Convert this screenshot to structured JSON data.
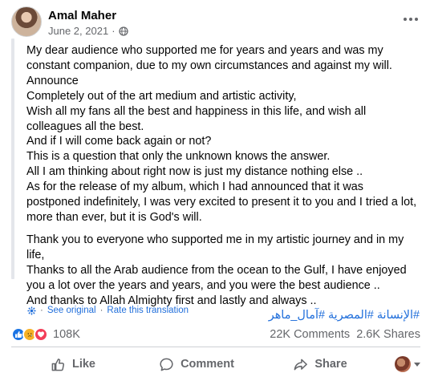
{
  "post": {
    "author": "Amal Maher",
    "date": "June 2, 2021",
    "date_separator": "·",
    "privacy_icon": "globe-icon",
    "more_icon": "more-horizontal-icon",
    "paragraphs": [
      [
        "My dear audience who supported me for years and years and was my constant companion, due to my own circumstances and against my will.",
        "Announce",
        "Completely out of the art medium and artistic activity,",
        "Wish all my fans all the best and happiness in this life, and wish all colleagues all the best.",
        "And if I will come back again or not?",
        "This is a question that only the unknown knows the answer.",
        "All I am thinking about right now is just my distance nothing else ..",
        "As for the release of my album, which I had announced that it was postponed indefinitely, I was very excited to present it to you and I tried a lot, more than ever, but it is God's will."
      ],
      [
        "Thank you to everyone who supported me in my artistic journey and in my life,",
        "Thanks to all the Arab audience from the ocean to the Gulf, I have enjoyed you a lot over the years and years, and you were the best audience ..",
        "And thanks to Allah Almighty first and lastly and always .."
      ]
    ],
    "hashtags": [
      "#آمال_ماهر",
      "#المصرية",
      "#الإنسانة"
    ],
    "see_original": "See original",
    "translate_separator": "·",
    "rate_translation": "Rate this translation"
  },
  "stats": {
    "reactions": [
      "like",
      "sad",
      "love"
    ],
    "reaction_count": "108K",
    "comments": "22K Comments",
    "shares": "2.6K Shares"
  },
  "actions": {
    "like": "Like",
    "comment": "Comment",
    "share": "Share"
  },
  "colors": {
    "link": "#216fdb",
    "secondary_text": "#65676b",
    "like_blue": "#1b74e4",
    "love_red": "#f33e58",
    "sad_yellow": "#f7b125"
  }
}
